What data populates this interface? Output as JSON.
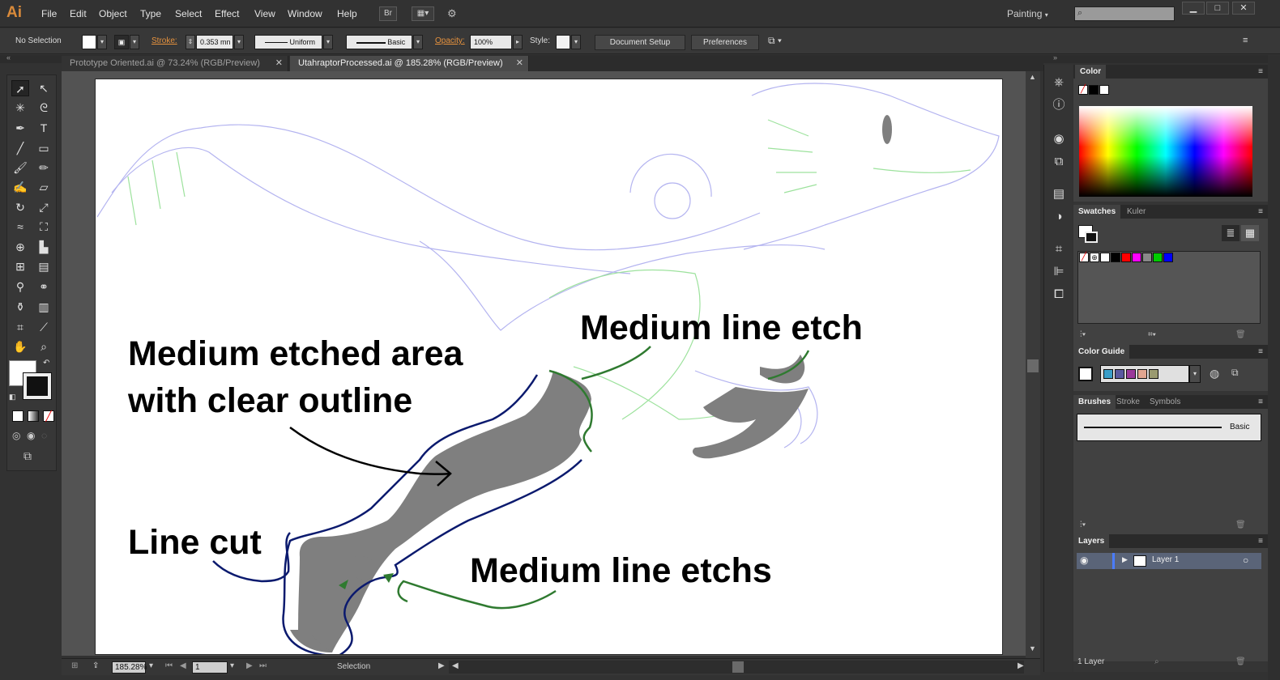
{
  "app": {
    "logo": "Ai",
    "menu": [
      "File",
      "Edit",
      "Object",
      "Type",
      "Select",
      "Effect",
      "View",
      "Window",
      "Help"
    ],
    "bridge_button": "Br",
    "workspace": "Painting",
    "window_controls": [
      "▁",
      "□",
      "✕"
    ]
  },
  "control_bar": {
    "selection_status": "No Selection",
    "stroke_label": "Stroke:",
    "stroke_value": "0.353 mn",
    "profile": "Uniform",
    "brush": "Basic",
    "opacity_label": "Opacity:",
    "opacity_value": "100%",
    "style_label": "Style:",
    "document_setup": "Document Setup",
    "preferences": "Preferences"
  },
  "tabs": [
    {
      "label": "Prototype Oriented.ai @ 73.24% (RGB/Preview)",
      "active": false
    },
    {
      "label": "UtahraptorProcessed.ai @ 185.28% (RGB/Preview)",
      "active": true
    }
  ],
  "tab_close_glyph": "✕",
  "annotations": {
    "medium_line_etch": "Medium line etch",
    "medium_etched_area_1": "Medium etched area",
    "medium_etched_area_2": "with clear outline",
    "line_cut": "Line cut",
    "medium_line_etchs": "Medium line etchs"
  },
  "status_bar": {
    "zoom": "185.28%",
    "artboard_number": "1",
    "status_text": "Selection"
  },
  "panels": {
    "color": {
      "title": "Color"
    },
    "swatches": {
      "tabs": [
        "Swatches",
        "Kuler"
      ]
    },
    "color_guide": {
      "title": "Color Guide",
      "colors": [
        "#3a9ec9",
        "#5a5aa0",
        "#9a3a9a",
        "#e0a590",
        "#9a9a70"
      ]
    },
    "brushes": {
      "tabs": [
        "Brushes",
        "Stroke",
        "Symbols"
      ],
      "brush_name": "Basic"
    },
    "layers": {
      "title": "Layers",
      "layer_name": "Layer 1",
      "footer": "1 Layer"
    }
  },
  "swatch_colors": [
    "#ffffff",
    "#000000",
    "#ff0000",
    "#ff00ff",
    "#888888",
    "#00cc00",
    "#0000ff"
  ],
  "colors": {
    "brand_orange": "#d98a3a",
    "etched_fill": "#7f7f7f",
    "outline_blue": "#0b1a6e",
    "etch_green": "#2f7a30",
    "guide_lilac": "#b4b4f0",
    "guide_green": "#9de29d"
  }
}
